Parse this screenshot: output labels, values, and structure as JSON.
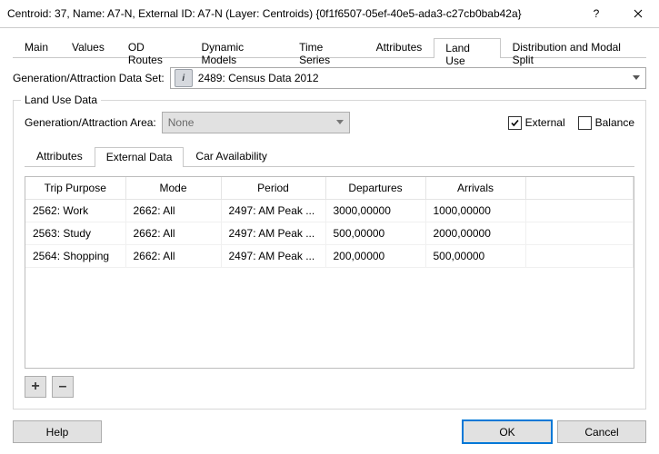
{
  "window": {
    "title": "Centroid: 37, Name: A7-N, External ID: A7-N (Layer: Centroids) {0f1f6507-05ef-40e5-ada3-c27cb0bab42a}",
    "help_glyph": "?",
    "close_glyph": "✕"
  },
  "tabs": {
    "items": [
      "Main",
      "Values",
      "OD Routes",
      "Dynamic Models",
      "Time Series",
      "Attributes",
      "Land Use",
      "Distribution and Modal Split"
    ],
    "active_index": 6
  },
  "dataset": {
    "label": "Generation/Attraction Data Set:",
    "value": "2489: Census Data 2012",
    "icon_glyph": "i"
  },
  "groupbox": {
    "title": "Land Use Data",
    "area_label": "Generation/Attraction Area:",
    "area_value": "None",
    "external_label": "External",
    "external_checked": true,
    "balance_label": "Balance",
    "balance_checked": false
  },
  "subtabs": {
    "items": [
      "Attributes",
      "External Data",
      "Car Availability"
    ],
    "active_index": 1
  },
  "table": {
    "headers": [
      "Trip Purpose",
      "Mode",
      "Period",
      "Departures",
      "Arrivals"
    ],
    "rows": [
      {
        "purpose": "2562: Work",
        "mode": "2662: All",
        "period": "2497: AM Peak ...",
        "departures": "3000,00000",
        "arrivals": "1000,00000"
      },
      {
        "purpose": "2563: Study",
        "mode": "2662: All",
        "period": "2497: AM Peak ...",
        "departures": "500,00000",
        "arrivals": "2000,00000"
      },
      {
        "purpose": "2564: Shopping",
        "mode": "2662: All",
        "period": "2497: AM Peak ...",
        "departures": "200,00000",
        "arrivals": "500,00000"
      }
    ]
  },
  "buttons": {
    "add": "+",
    "remove": "–",
    "help": "Help",
    "ok": "OK",
    "cancel": "Cancel"
  }
}
